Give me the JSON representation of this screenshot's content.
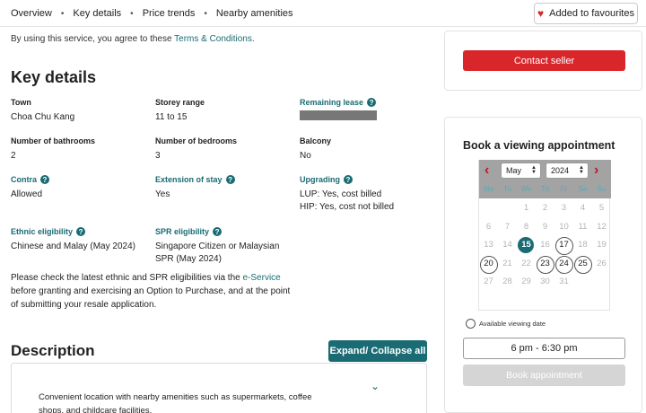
{
  "nav": {
    "tabs": [
      "Overview",
      "Key details",
      "Price trends",
      "Nearby amenities"
    ],
    "separator": "•",
    "favourite_label": "Added to favourites"
  },
  "terms": {
    "prefix": "By using this service, you agree to these ",
    "link": "Terms & Conditions",
    "suffix": "."
  },
  "key_details": {
    "heading": "Key details",
    "town": {
      "label": "Town",
      "value": "Choa Chu Kang"
    },
    "storey": {
      "label": "Storey range",
      "value": "11 to 15"
    },
    "lease": {
      "label": "Remaining lease"
    },
    "bathrooms": {
      "label": "Number of bathrooms",
      "value": "2"
    },
    "bedrooms": {
      "label": "Number of bedrooms",
      "value": "3"
    },
    "balcony": {
      "label": "Balcony",
      "value": "No"
    },
    "contra": {
      "label": "Contra",
      "value": "Allowed"
    },
    "extension": {
      "label": "Extension of stay",
      "value": "Yes"
    },
    "upgrading": {
      "label": "Upgrading",
      "line1": "LUP: Yes, cost billed",
      "line2": "HIP: Yes, cost not billed"
    },
    "ethnic": {
      "label": "Ethnic eligibility",
      "value": "Chinese and Malay (May 2024)"
    },
    "spr": {
      "label": "SPR eligibility",
      "line1": "Singapore Citizen or Malaysian",
      "line2": "SPR (May 2024)"
    },
    "help_icon": "?"
  },
  "note": {
    "prefix": "Please check the latest ethnic and SPR eligibilities via the ",
    "link": "e-Service",
    "suffix": " before granting and exercising an Option to Purchase, and at the point of submitting your resale application."
  },
  "description": {
    "heading": "Description",
    "expand_label": "Expand/ Collapse all",
    "text": "Convenient location with nearby amenities such as supermarkets, coffee shops, and childcare facilities."
  },
  "seller": {
    "contact_label": "Contact seller"
  },
  "booking": {
    "heading": "Book a viewing appointment",
    "month": "May",
    "year": "2024",
    "days_of_week": [
      "Mo",
      "Tu",
      "We",
      "Th",
      "Fr",
      "Sa",
      "Su"
    ],
    "weeks": [
      [
        "",
        "",
        "1",
        "2",
        "3",
        "4",
        "5"
      ],
      [
        "6",
        "7",
        "8",
        "9",
        "10",
        "11",
        "12"
      ],
      [
        "13",
        "14",
        "15",
        "16",
        "17",
        "18",
        "19"
      ],
      [
        "20",
        "21",
        "22",
        "23",
        "24",
        "25",
        "26"
      ],
      [
        "27",
        "28",
        "29",
        "30",
        "31",
        "",
        ""
      ]
    ],
    "today": "15",
    "available_dates": [
      "17",
      "20",
      "23",
      "24",
      "25"
    ],
    "legend_label": "Available viewing date",
    "time_slot": "6 pm - 6:30 pm",
    "book_label": "Book appointment"
  },
  "colors": {
    "brand_red": "#d9262a",
    "teal": "#1a6b73"
  }
}
